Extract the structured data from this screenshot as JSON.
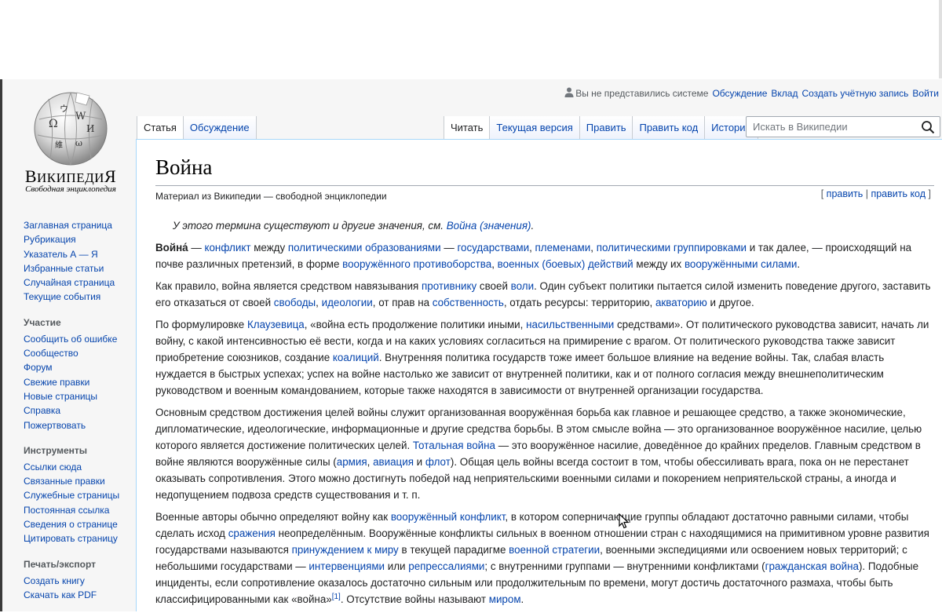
{
  "logo": {
    "wordmark": "Википедия",
    "tagline": "Свободная энциклопедия"
  },
  "sidebar": {
    "main": [
      {
        "label": "Заглавная страница"
      },
      {
        "label": "Рубрикация"
      },
      {
        "label": "Указатель А — Я"
      },
      {
        "label": "Избранные статьи"
      },
      {
        "label": "Случайная страница"
      },
      {
        "label": "Текущие события"
      }
    ],
    "participation": {
      "heading": "Участие",
      "items": [
        {
          "label": "Сообщить об ошибке"
        },
        {
          "label": "Сообщество"
        },
        {
          "label": "Форум"
        },
        {
          "label": "Свежие правки"
        },
        {
          "label": "Новые страницы"
        },
        {
          "label": "Справка"
        },
        {
          "label": "Пожертвовать"
        }
      ]
    },
    "tools": {
      "heading": "Инструменты",
      "items": [
        {
          "label": "Ссылки сюда"
        },
        {
          "label": "Связанные правки"
        },
        {
          "label": "Служебные страницы"
        },
        {
          "label": "Постоянная ссылка"
        },
        {
          "label": "Сведения о странице"
        },
        {
          "label": "Цитировать страницу"
        }
      ]
    },
    "print": {
      "heading": "Печать/экспорт",
      "items": [
        {
          "label": "Создать книгу"
        },
        {
          "label": "Скачать как PDF"
        }
      ]
    }
  },
  "personal": {
    "not_logged": "Вы не представились системе",
    "talk": "Обсуждение",
    "contributions": "Вклад",
    "create_account": "Создать учётную запись",
    "login": "Войти"
  },
  "tabs": {
    "article": "Статья",
    "discussion": "Обсуждение",
    "read": "Читать",
    "current": "Текущая версия",
    "edit": "Править",
    "edit_source": "Править код",
    "history": "История"
  },
  "search": {
    "placeholder": "Искать в Википедии"
  },
  "article": {
    "title": "Война",
    "site_sub": "Материал из Википедии — свободной энциклопедии",
    "edit_links": {
      "open": "[",
      "edit": "править",
      "sep": "|",
      "edit_source": "править код",
      "close": "]"
    },
    "hatnote": {
      "text": "У этого термина существуют и другие значения, см. ",
      "link": "Война (значения)",
      "end": "."
    },
    "paragraphs": [
      [
        {
          "t": "Война́",
          "b": true
        },
        {
          "t": " — "
        },
        {
          "t": "конфликт",
          "l": true
        },
        {
          "t": " между "
        },
        {
          "t": "политическими образованиями",
          "l": true
        },
        {
          "t": " — "
        },
        {
          "t": "государствами",
          "l": true
        },
        {
          "t": ", "
        },
        {
          "t": "племенами",
          "l": true
        },
        {
          "t": ", "
        },
        {
          "t": "политическими группировками",
          "l": true
        },
        {
          "t": " и так далее, — происходящий на почве различных претензий, в форме "
        },
        {
          "t": "вооружённого противоборства",
          "l": true
        },
        {
          "t": ", "
        },
        {
          "t": "военных (боевых) действий",
          "l": true
        },
        {
          "t": " между их "
        },
        {
          "t": "вооружёнными силами",
          "l": true
        },
        {
          "t": "."
        }
      ],
      [
        {
          "t": "Как правило, война является средством навязывания "
        },
        {
          "t": "противнику",
          "l": true
        },
        {
          "t": " своей "
        },
        {
          "t": "воли",
          "l": true
        },
        {
          "t": ". Один субъект политики пытается силой изменить поведение другого, заставить его отказаться от своей "
        },
        {
          "t": "свободы",
          "l": true
        },
        {
          "t": ", "
        },
        {
          "t": "идеологии",
          "l": true
        },
        {
          "t": ", от прав на "
        },
        {
          "t": "собственность",
          "l": true
        },
        {
          "t": ", отдать ресурсы: территорию, "
        },
        {
          "t": "акваторию",
          "l": true
        },
        {
          "t": " и другое."
        }
      ],
      [
        {
          "t": "По формулировке "
        },
        {
          "t": "Клаузевица",
          "l": true
        },
        {
          "t": ", «война есть продолжение политики иными, "
        },
        {
          "t": "насильственными",
          "l": true
        },
        {
          "t": " средствами». От политического руководства зависит, начать ли войну, с какой интенсивностью её вести, когда и на каких условиях согласиться на примирение с врагом. От политического руководства также зависит приобретение союзников, создание "
        },
        {
          "t": "коалиций",
          "l": true
        },
        {
          "t": ". Внутренняя политика государств тоже имеет большое влияние на ведение войны. Так, слабая власть нуждается в быстрых успехах; успех на войне настолько же зависит от внутренней политики, как и от полного согласия между внешнеполитическим руководством и военным командованием, которые также находятся в зависимости от внутренней организации государства."
        }
      ],
      [
        {
          "t": "Основным средством достижения целей войны служит организованная вооружённая борьба как главное и решающее средство, а также экономические, дипломатические, идеологические, информационные и другие средства борьбы. В этом смысле война — это организованное вооружённое насилие, целью которого является достижение политических целей. "
        },
        {
          "t": "Тотальная война",
          "l": true
        },
        {
          "t": " — это вооружённое насилие, доведённое до крайних пределов. Главным средством в войне являются вооружённые силы ("
        },
        {
          "t": "армия",
          "l": true
        },
        {
          "t": ", "
        },
        {
          "t": "авиация",
          "l": true
        },
        {
          "t": " и "
        },
        {
          "t": "флот",
          "l": true
        },
        {
          "t": "). Общая цель войны всегда состоит в том, чтобы обессиливать врага, пока он не перестанет оказывать сопротивления. Этого можно достигнуть победой над неприятельскими военными силами и покорением неприятельской страны, а иногда и недопущением подвоза средств существования и т. п."
        }
      ],
      [
        {
          "t": "Военные авторы обычно определяют войну как "
        },
        {
          "t": "вооружённый конфликт",
          "l": true
        },
        {
          "t": ", в котором соперничающие группы обладают достаточно равными силами, чтобы сделать исход "
        },
        {
          "t": "сражения",
          "l": true
        },
        {
          "t": " неопределённым. Вооружённые конфликты сильных в военном отношении стран с находящимися на примитивном уровне развития государствами называются "
        },
        {
          "t": "принуждением к миру",
          "l": true
        },
        {
          "t": " в текущей парадигме "
        },
        {
          "t": "военной стратегии",
          "l": true
        },
        {
          "t": ", военными экспедициями или освоением новых территорий; с небольшими государствами — "
        },
        {
          "t": "интервенциями",
          "l": true
        },
        {
          "t": " или "
        },
        {
          "t": "репрессалиями",
          "l": true
        },
        {
          "t": "; с внутренними группами — внутренними конфликтами ("
        },
        {
          "t": "гражданская война",
          "l": true
        },
        {
          "t": "). Подобные инциденты, если сопротивление оказалось достаточно сильным или продолжительным по времени, могут достичь достаточного размаха, чтобы быть классифицированными как «война»"
        },
        {
          "t": "[1]",
          "sup": true,
          "l": true
        },
        {
          "t": ". Отсутствие войны называют "
        },
        {
          "t": "миром",
          "l": true
        },
        {
          "t": "."
        }
      ]
    ]
  }
}
